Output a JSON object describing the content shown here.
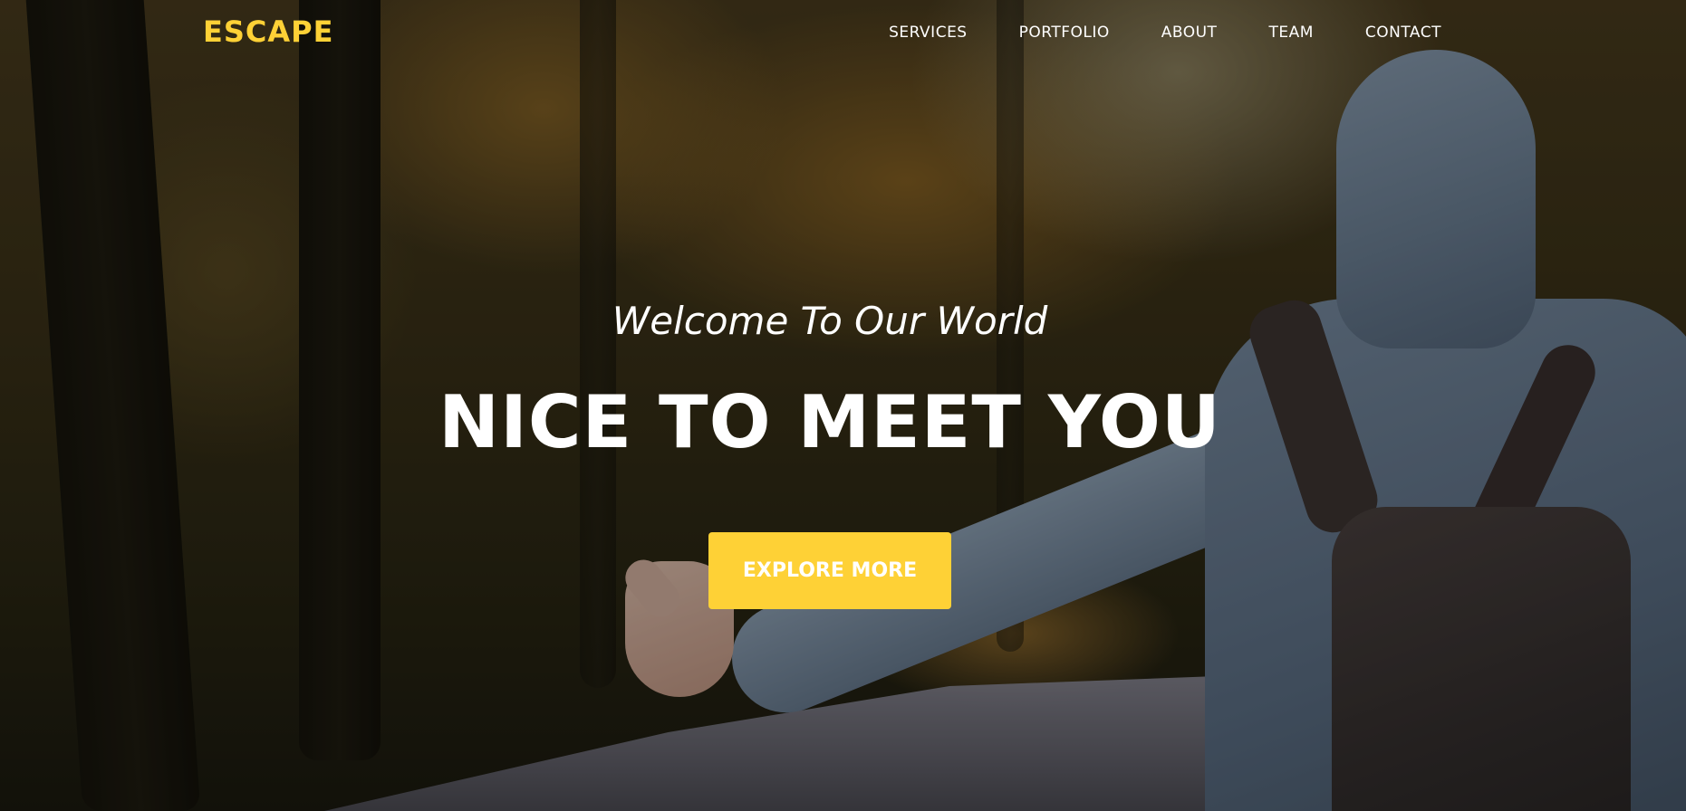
{
  "navbar": {
    "brand": "ESCAPE",
    "links": [
      {
        "label": "SERVICES"
      },
      {
        "label": "PORTFOLIO"
      },
      {
        "label": "ABOUT"
      },
      {
        "label": "TEAM"
      },
      {
        "label": "CONTACT"
      }
    ]
  },
  "intro": {
    "lead_in": "Welcome To Our World",
    "heading": "NICE TO MEET YOU",
    "cta_label": "EXPLORE MORE"
  },
  "colors": {
    "brand_accent": "#fed136",
    "text": "#ffffff"
  }
}
